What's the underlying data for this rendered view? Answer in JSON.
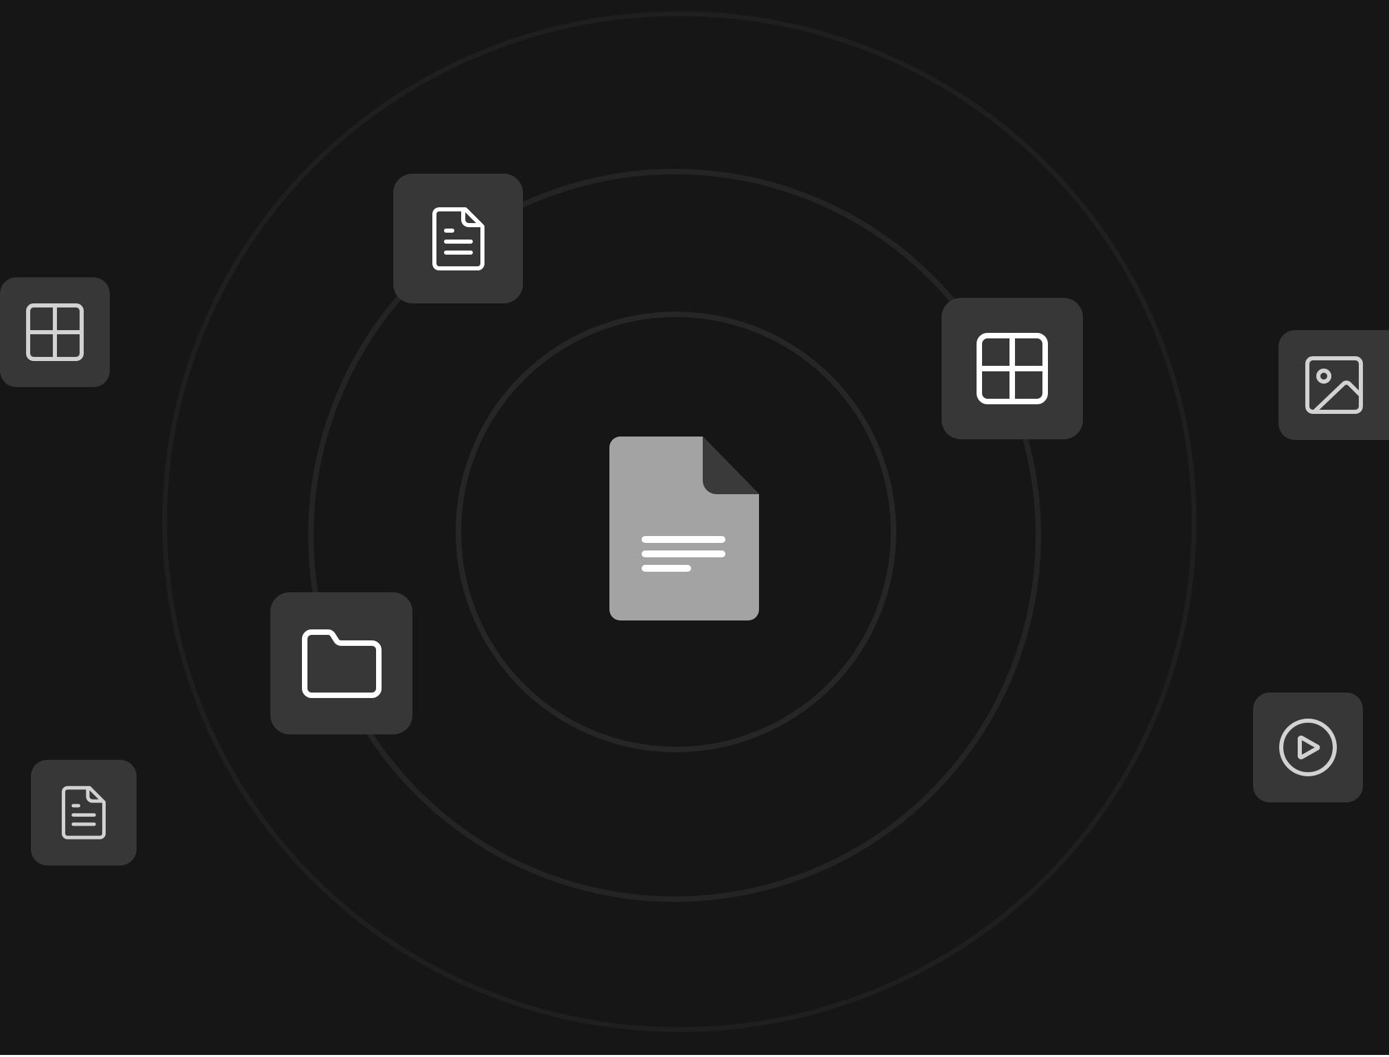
{
  "colors": {
    "background": "#161616",
    "ring": "#262626",
    "tile": "#373737",
    "icon_bright": "#ffffff",
    "icon_muted": "#d2d2d2",
    "center_doc": "#a3a3a3",
    "center_doc_fold": "#3a3a3a"
  },
  "center": {
    "icon": "document-icon"
  },
  "tiles": [
    {
      "name": "table-tile-left",
      "icon": "table-icon"
    },
    {
      "name": "document-tile-top",
      "icon": "document-icon"
    },
    {
      "name": "table-tile-right",
      "icon": "table-icon"
    },
    {
      "name": "image-tile",
      "icon": "image-icon"
    },
    {
      "name": "folder-tile",
      "icon": "folder-icon"
    },
    {
      "name": "document-tile-bottom-left",
      "icon": "document-icon"
    },
    {
      "name": "play-tile",
      "icon": "play-icon"
    }
  ]
}
